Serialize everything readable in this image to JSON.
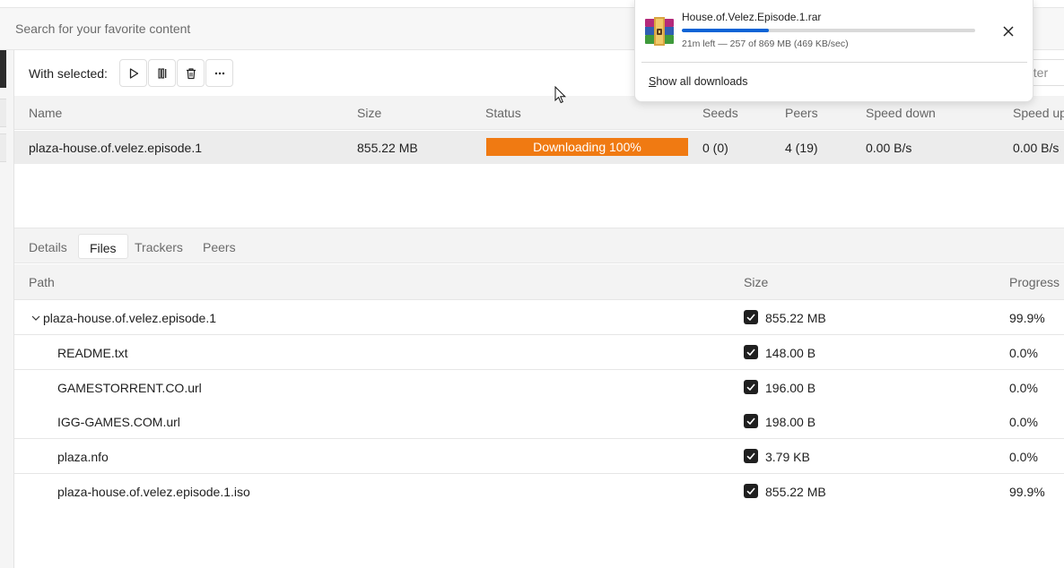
{
  "search": {
    "placeholder": "Search for your favorite content"
  },
  "toolbar": {
    "with_selected_label": "With selected:",
    "filter_placeholder": "Filter"
  },
  "torrents": {
    "columns": {
      "name": "Name",
      "size": "Size",
      "status": "Status",
      "seeds": "Seeds",
      "peers": "Peers",
      "speed_down": "Speed down",
      "speed_up": "Speed up"
    },
    "rows": [
      {
        "name": "plaza-house.of.velez.episode.1",
        "size": "855.22 MB",
        "status": "Downloading 100%",
        "seeds": "0 (0)",
        "peers": "4 (19)",
        "speed_down": "0.00 B/s",
        "speed_up": "0.00 B/s"
      }
    ]
  },
  "detail_tabs": {
    "items": [
      {
        "label": "Details",
        "active": false
      },
      {
        "label": "Files",
        "active": true
      },
      {
        "label": "Trackers",
        "active": false
      },
      {
        "label": "Peers",
        "active": false
      }
    ]
  },
  "files": {
    "columns": {
      "path": "Path",
      "size": "Size",
      "progress": "Progress"
    },
    "rows": [
      {
        "path": "plaza-house.of.velez.episode.1",
        "size": "855.22 MB",
        "progress": "99.9%",
        "checked": true,
        "folder": true
      },
      {
        "path": "README.txt",
        "size": "148.00 B",
        "progress": "0.0%",
        "checked": true,
        "folder": false
      },
      {
        "path": "GAMESTORRENT.CO.url",
        "size": "196.00 B",
        "progress": "0.0%",
        "checked": true,
        "folder": false
      },
      {
        "path": "IGG-GAMES.COM.url",
        "size": "198.00 B",
        "progress": "0.0%",
        "checked": true,
        "folder": false
      },
      {
        "path": "plaza.nfo",
        "size": "3.79 KB",
        "progress": "0.0%",
        "checked": true,
        "folder": false
      },
      {
        "path": "plaza-house.of.velez.episode.1.iso",
        "size": "855.22 MB",
        "progress": "99.9%",
        "checked": true,
        "folder": false
      }
    ]
  },
  "download_popup": {
    "file_name": "House.of.Velez.Episode.1.rar",
    "status_text": "21m left — 257 of 869 MB (469 KB/sec)",
    "progress_fraction": 0.296,
    "show_all_label": "Show all downloads",
    "show_all_accesskey": "S",
    "show_all_rest": "how all downloads",
    "accent_color": "#0a63d6"
  },
  "colors": {
    "status_downloading": "#f07a12",
    "progress_accent": "#0a63d6"
  },
  "icons": {
    "play": "play-icon",
    "pause": "pause-icon",
    "delete": "trash-icon",
    "more": "more-horizontal-icon",
    "close": "close-icon",
    "expand": "chevron-down-icon",
    "archive": "winrar-archive-icon",
    "checkbox": "checkbox-checked-icon"
  }
}
